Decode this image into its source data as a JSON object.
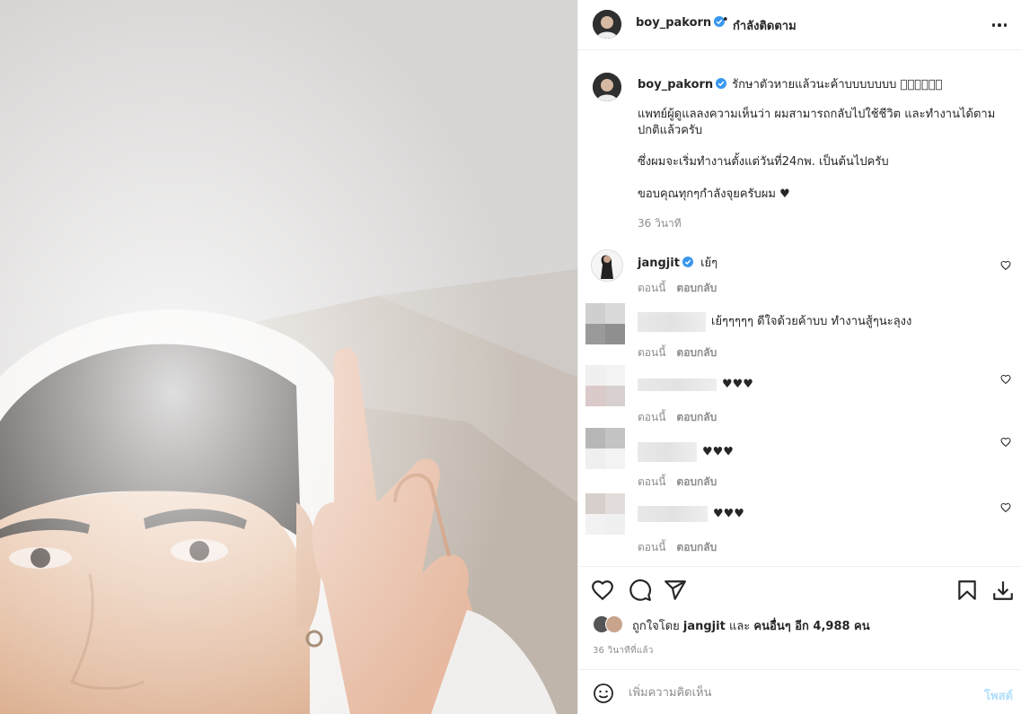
{
  "colors": {
    "verified": "#3897f0",
    "accent": "#0095f6",
    "post_disabled": "#b2dffc",
    "muted": "#8e8e8e",
    "text": "#262626"
  },
  "photo": {
    "description_icon": "selfie-photo"
  },
  "header": {
    "username": "boy_pakorn",
    "separator": "•",
    "follow_status": "กำลังติดตาม",
    "more_icon": "more-options-icon"
  },
  "caption": {
    "username": "boy_pakorn",
    "first_line": "รักษาตัวหายแล้วนะค้าบบบบบบบ 􀀀􀀀􀀀􀀀􀀀􀀀",
    "lines": [
      "แพทย์ผู้ดูแลลงความเห็นว่า ผมสามารถกลับไปใช้ชีวิต และทำงานได้ตาม",
      "ปกติแล้วครับ",
      "ซึ่งผมจะเริ่มทำงานตั้งแต่วันที่24กพ. เป็นต้นไปครับ",
      "ขอบคุณทุกๆกำลังจุยครับผม ♥"
    ],
    "time": "36 วินาที"
  },
  "comments": [
    {
      "username": "jangjit",
      "text": "เย้ๆ",
      "time": "ตอนนี้",
      "reply": "ตอบกลับ"
    },
    {
      "username": "",
      "text": "เย้ๆๆๆๆๆ ดีใจด้วยค้าบบ ทำงานสู้ๆนะลุงง",
      "time": "ตอนนี้",
      "reply": "ตอบกลับ"
    },
    {
      "username": "",
      "text": "♥♥♥",
      "time": "ตอนนี้",
      "reply": "ตอบกลับ"
    },
    {
      "username": "",
      "text": "♥♥♥",
      "time": "ตอนนี้",
      "reply": "ตอบกลับ"
    },
    {
      "username": "",
      "text": "♥♥♥",
      "time": "ตอนนี้",
      "reply": "ตอบกลับ"
    }
  ],
  "actions": {
    "icons": [
      "heart-icon",
      "comment-icon",
      "share-icon",
      "bookmark-icon",
      "download-icon"
    ],
    "likes_prefix": "ถูกใจโดย",
    "likes_user": "jangjit",
    "likes_and": "และ",
    "likes_others": "คนอื่นๆ อีก 4,988 คน",
    "post_time": "36 วินาทีที่แล้ว"
  },
  "add_comment": {
    "placeholder": "เพิ่มความคิดเห็น",
    "post_label": "โพสต์"
  }
}
